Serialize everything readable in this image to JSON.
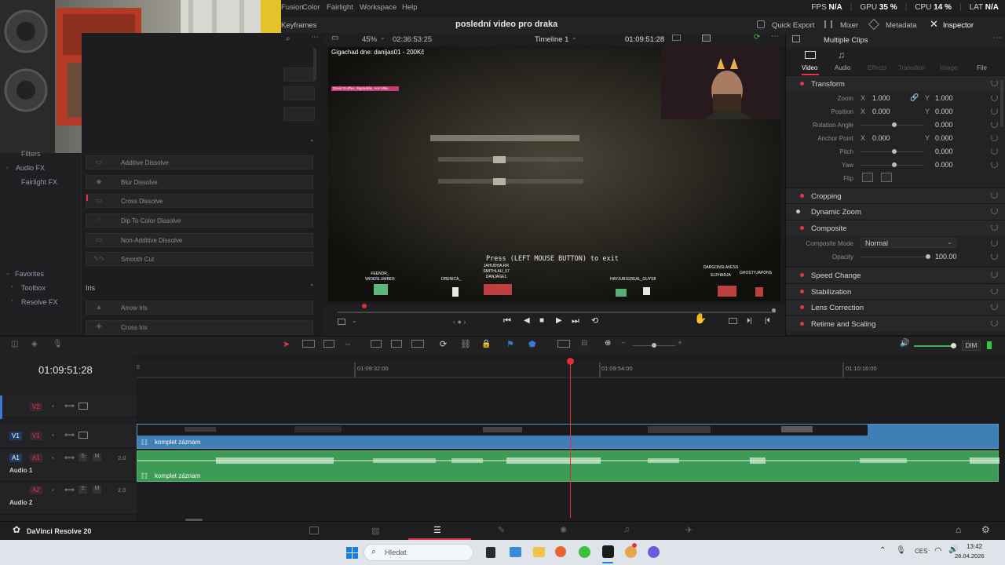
{
  "menubar": {
    "items": [
      "Fusion",
      "Color",
      "Fairlight",
      "Workspace",
      "Help"
    ],
    "stats": {
      "fps_label": "FPS",
      "fps_value": "N/A",
      "gpu_label": "GPU",
      "gpu_value": "35 %",
      "cpu_label": "CPU",
      "cpu_value": "14 %",
      "lat_label": "LAT",
      "lat_value": "N/A"
    }
  },
  "toolbar2": {
    "keyframes": "Keyframes",
    "project_title": "poslední video pro draka",
    "quick_export": "Quick Export",
    "mixer": "Mixer",
    "metadata": "Metadata",
    "inspector": "Inspector"
  },
  "viewer": {
    "zoom": "45%",
    "source_tc": "02:36:53:25",
    "timeline_name": "Timeline 1",
    "record_tc": "01:09:51:28",
    "overlay_banner": "Gigachad dne: danijas01 - 200Kč",
    "game_message": "Press (LEFT MOUSE BUTTON) to exit",
    "players": [
      "FEENDR_ WIDERLUMBER",
      "DRENICA_",
      "JAHUDHA.RR SMITHLAU_57 DANJAGE1",
      "HAYJUB1EREAL_GUYS8",
      "DARGONSLAVESS ELFHARJA",
      "GHOSTYJAPONS"
    ],
    "chat_line": "Dávid Gorffes, Bigdaddie, Ace Mike"
  },
  "inspector": {
    "header": "Multiple Clips",
    "tabs": [
      "Video",
      "Audio",
      "Effects",
      "Transition",
      "Image",
      "File"
    ],
    "transform_title": "Transform",
    "props": {
      "zoom": {
        "label": "Zoom",
        "x": "1.000",
        "y": "1.000"
      },
      "position": {
        "label": "Position",
        "x": "0.000",
        "y": "0.000"
      },
      "rotation": {
        "label": "Rotation Angle",
        "v": "0.000"
      },
      "anchor": {
        "label": "Anchor Point",
        "x": "0.000",
        "y": "0.000"
      },
      "pitch": {
        "label": "Pitch",
        "v": "0.000"
      },
      "yaw": {
        "label": "Yaw",
        "v": "0.000"
      },
      "flip": {
        "label": "Flip"
      }
    },
    "axis_x": "X",
    "axis_y": "Y",
    "cropping": "Cropping",
    "dynamic_zoom": "Dynamic Zoom",
    "composite": "Composite",
    "composite_mode_label": "Composite Mode",
    "composite_mode_value": "Normal",
    "opacity_label": "Opacity",
    "opacity_value": "100.00",
    "speed_change": "Speed Change",
    "stabilization": "Stabilization",
    "lens_correction": "Lens Correction",
    "retime_scaling": "Retime and Scaling"
  },
  "leftnav": {
    "filters": "Filters",
    "audio_fx": "Audio FX",
    "fairlight_fx": "Fairlight FX",
    "favorites": "Favorites",
    "toolbox": "Toolbox",
    "resolve_fx": "Resolve FX"
  },
  "effects": {
    "dissolve_items": [
      "Additive Dissolve",
      "Blur Dissolve",
      "Cross Dissolve",
      "Dip To Color Dissolve",
      "Non-Additive Dissolve",
      "Smooth Cut"
    ],
    "iris_header": "Iris",
    "iris_items": [
      "Arrow Iris",
      "Cross Iris"
    ]
  },
  "timeline": {
    "timecode": "01:09:51:28",
    "ruler_labels": [
      "01:09:32:00",
      "01:09:54:00",
      "01:10:16:00"
    ],
    "tracks": {
      "v2": "V2",
      "v1": "V1",
      "a1": "A1",
      "a1_name": "Audio 1",
      "a2": "A2",
      "a2_name": "Audio 2",
      "a_level": "2.0",
      "s": "S",
      "m": "M"
    },
    "clip_name": "komplet záznam",
    "dim": "DIM"
  },
  "pagebar": {
    "app_name": "DaVinci Resolve 20"
  },
  "taskbar": {
    "search_placeholder": "Hledat",
    "lang": "CES",
    "time": "13:42",
    "date": "28.04.2026"
  },
  "colors": {
    "accent_red": "#e0384a",
    "video_clip": "#3f7fb5",
    "audio_clip": "#3d9b55",
    "playhead": "#e03030"
  }
}
